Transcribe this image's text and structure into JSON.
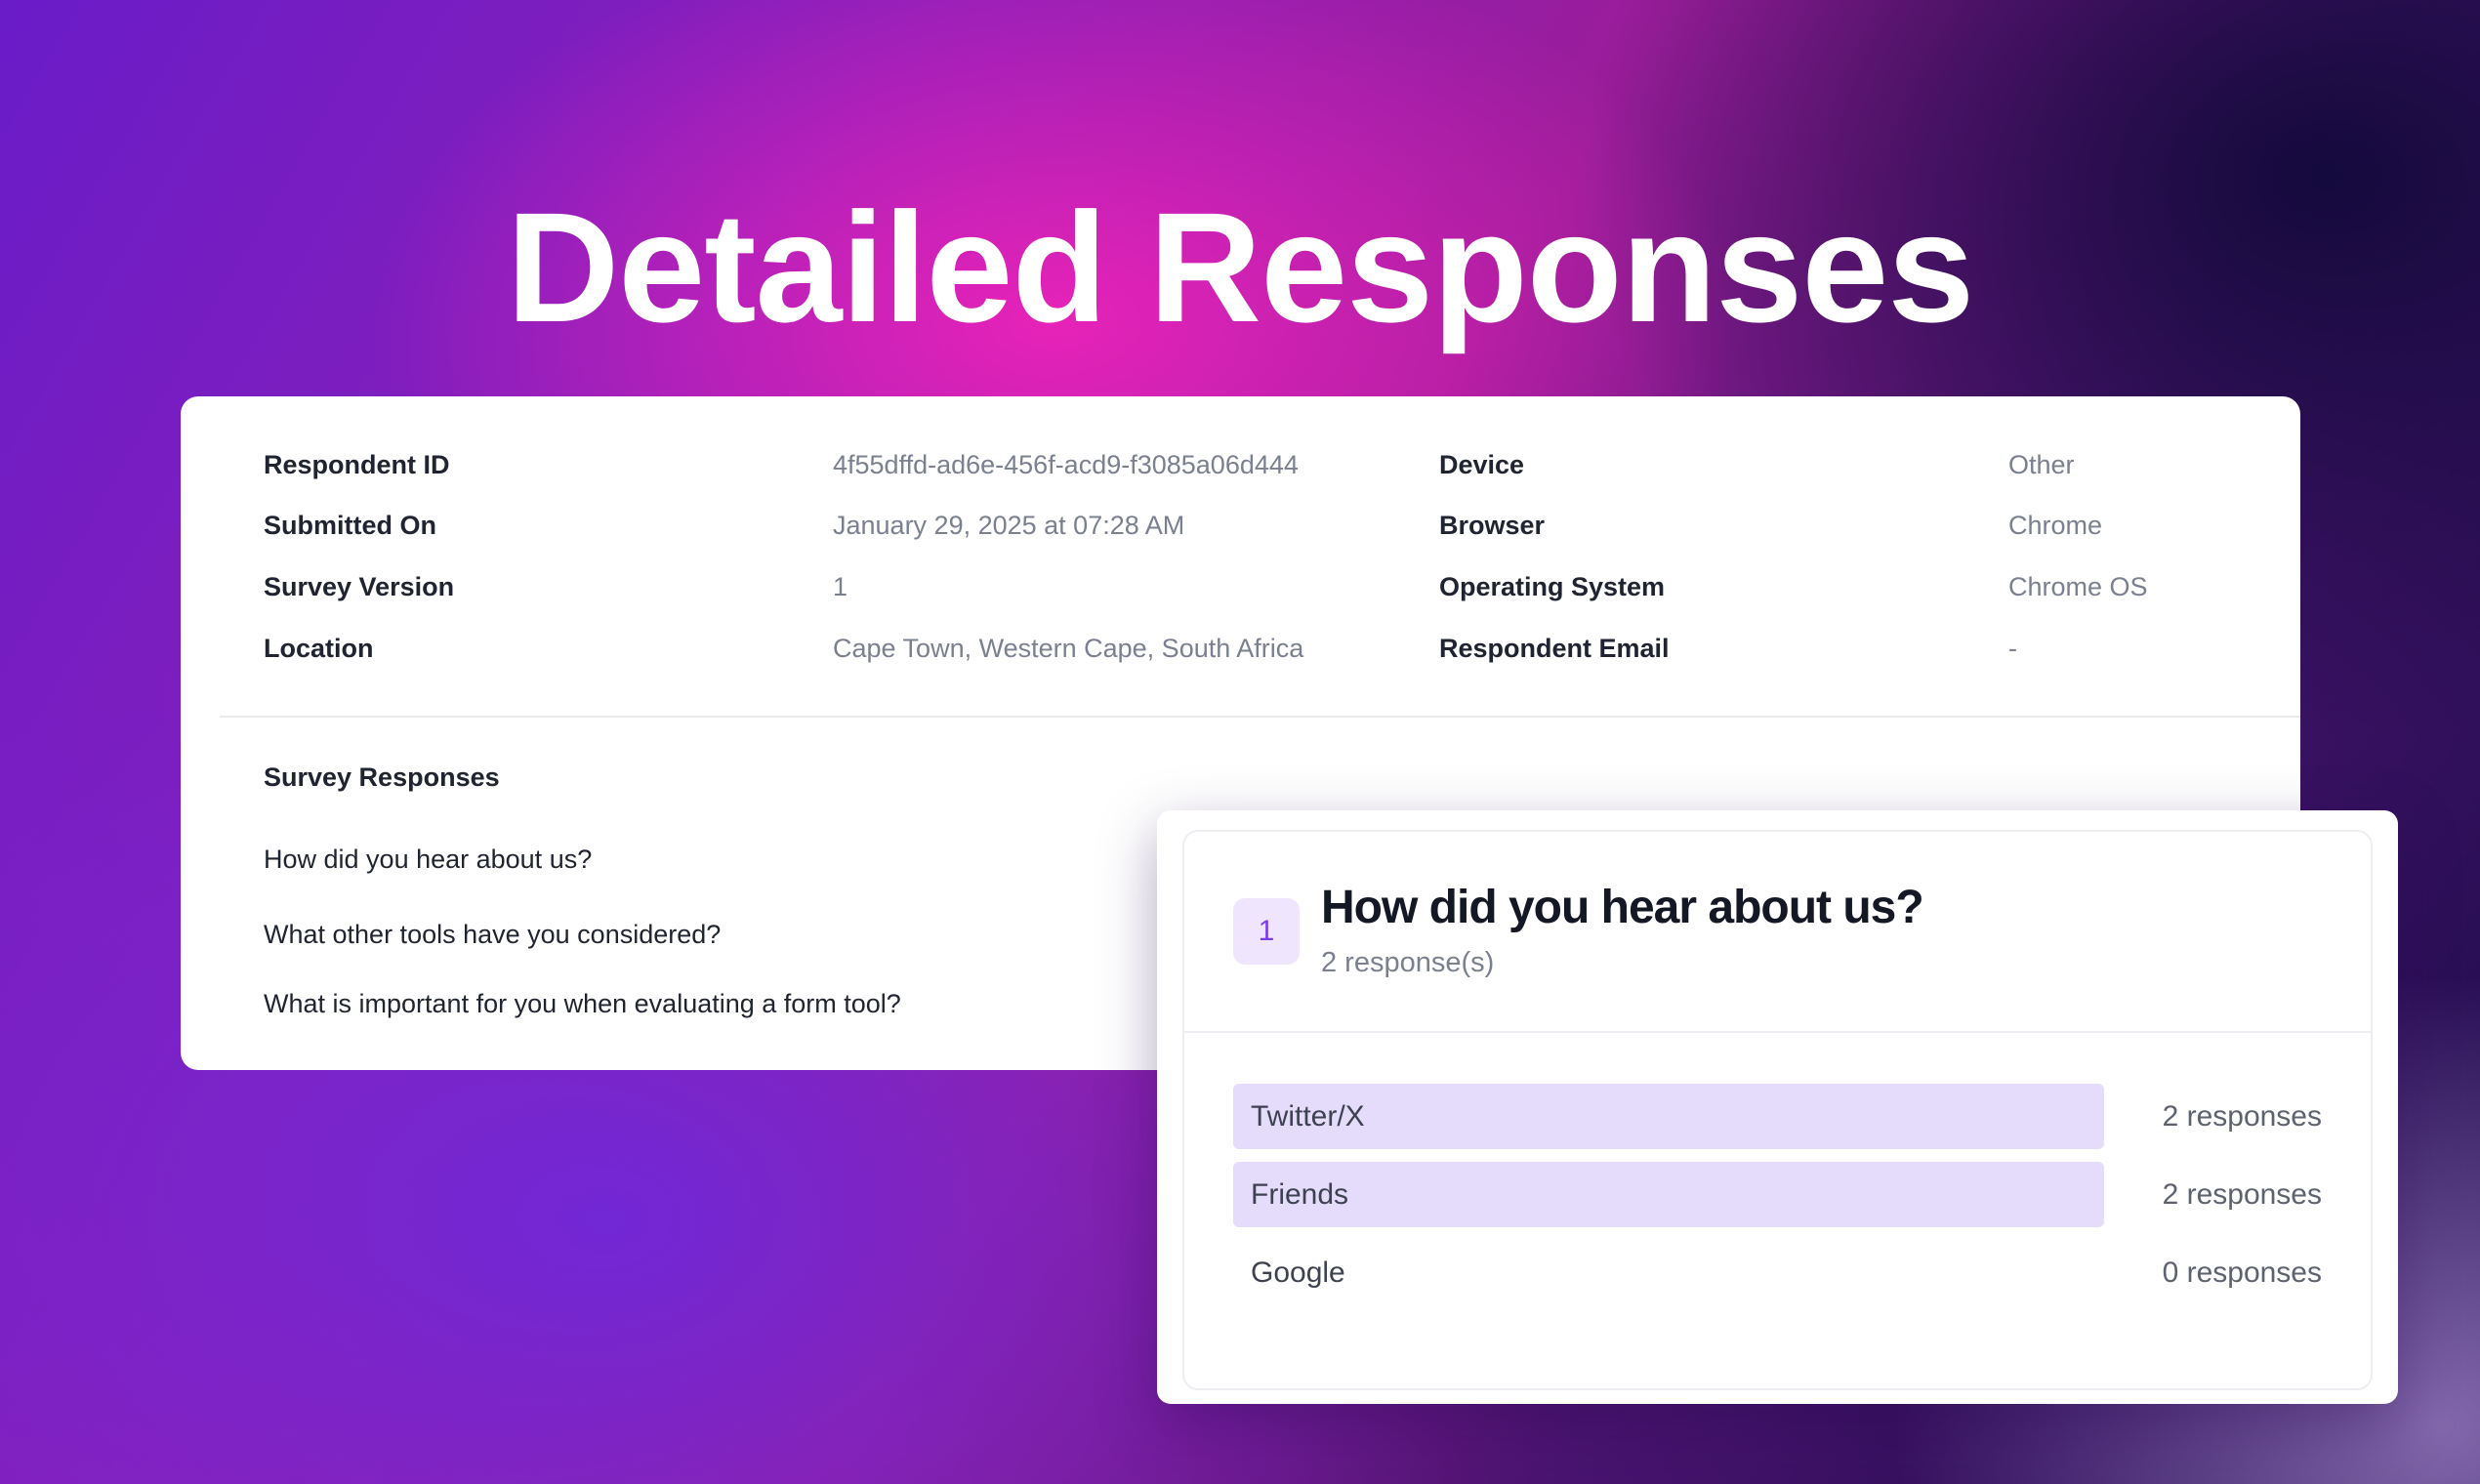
{
  "hero": {
    "title": "Detailed Responses"
  },
  "details": {
    "left": [
      {
        "label": "Respondent ID",
        "value": "4f55dffd-ad6e-456f-acd9-f3085a06d444"
      },
      {
        "label": "Submitted On",
        "value": "January 29, 2025 at 07:28 AM"
      },
      {
        "label": "Survey Version",
        "value": "1"
      },
      {
        "label": "Location",
        "value": "Cape Town, Western Cape, South Africa"
      }
    ],
    "right": [
      {
        "label": "Device",
        "value": "Other"
      },
      {
        "label": "Browser",
        "value": "Chrome"
      },
      {
        "label": "Operating System",
        "value": "Chrome OS"
      },
      {
        "label": "Respondent Email",
        "value": "-"
      }
    ]
  },
  "survey": {
    "section_title": "Survey Responses",
    "questions": [
      "How did you hear about us?",
      "What other tools have you considered?",
      "What is important for you when evaluating a form tool?"
    ]
  },
  "summary": {
    "number": "1",
    "question": "How did you hear about us?",
    "subtitle": "2 response(s)",
    "accent_color": "#7c3aed",
    "bar_color": "#e5dbfb",
    "options": [
      {
        "label": "Twitter/X",
        "count": "2 responses",
        "fraction": 1.0
      },
      {
        "label": "Friends",
        "count": "2 responses",
        "fraction": 1.0
      },
      {
        "label": "Google",
        "count": "0 responses",
        "fraction": 0.0
      }
    ]
  }
}
